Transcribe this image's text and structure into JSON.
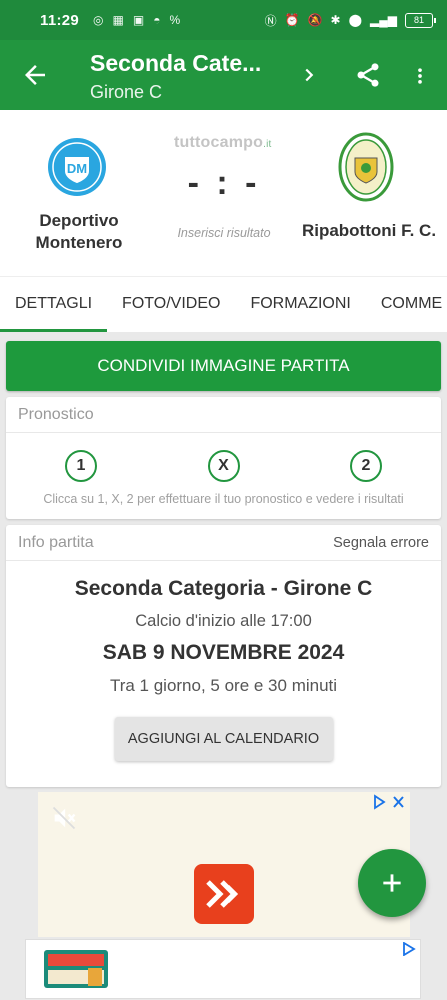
{
  "status_bar": {
    "time": "11:29",
    "battery": "81"
  },
  "app_bar": {
    "title": "Seconda Cate...",
    "subtitle": "Girone C"
  },
  "match": {
    "brand": "tuttocampo",
    "brand_suffix": ".it",
    "score": "- : -",
    "score_hint": "Inserisci risultato",
    "home_team": "Deportivo Montenero",
    "away_team": "Ripabottoni F. C."
  },
  "tabs": [
    "DETTAGLI",
    "FOTO/VIDEO",
    "FORMAZIONI",
    "COMME"
  ],
  "share_button": "CONDIVIDI IMMAGINE PARTITA",
  "prediction": {
    "title": "Pronostico",
    "options": [
      "1",
      "X",
      "2"
    ],
    "note": "Clicca su 1, X, 2 per effettuare il tuo pronostico e vedere i risultati"
  },
  "info": {
    "title": "Info partita",
    "report_error": "Segnala errore",
    "competition": "Seconda Categoria - Girone C",
    "kickoff": "Calcio d'inizio alle 17:00",
    "date": "SAB 9 NOVEMBRE 2024",
    "countdown": "Tra 1 giorno, 5 ore e 30 minuti",
    "calendar_button": "AGGIUNGI AL CALENDARIO"
  },
  "colors": {
    "primary": "#22963f",
    "status_bar": "#1f8a3c",
    "ad_logo": "#e8401d"
  },
  "icons": {
    "back": "arrow-back-icon",
    "next": "chevron-right-icon",
    "share": "share-icon",
    "more": "more-vert-icon",
    "fab": "plus-icon",
    "mute": "volume-off-icon"
  }
}
